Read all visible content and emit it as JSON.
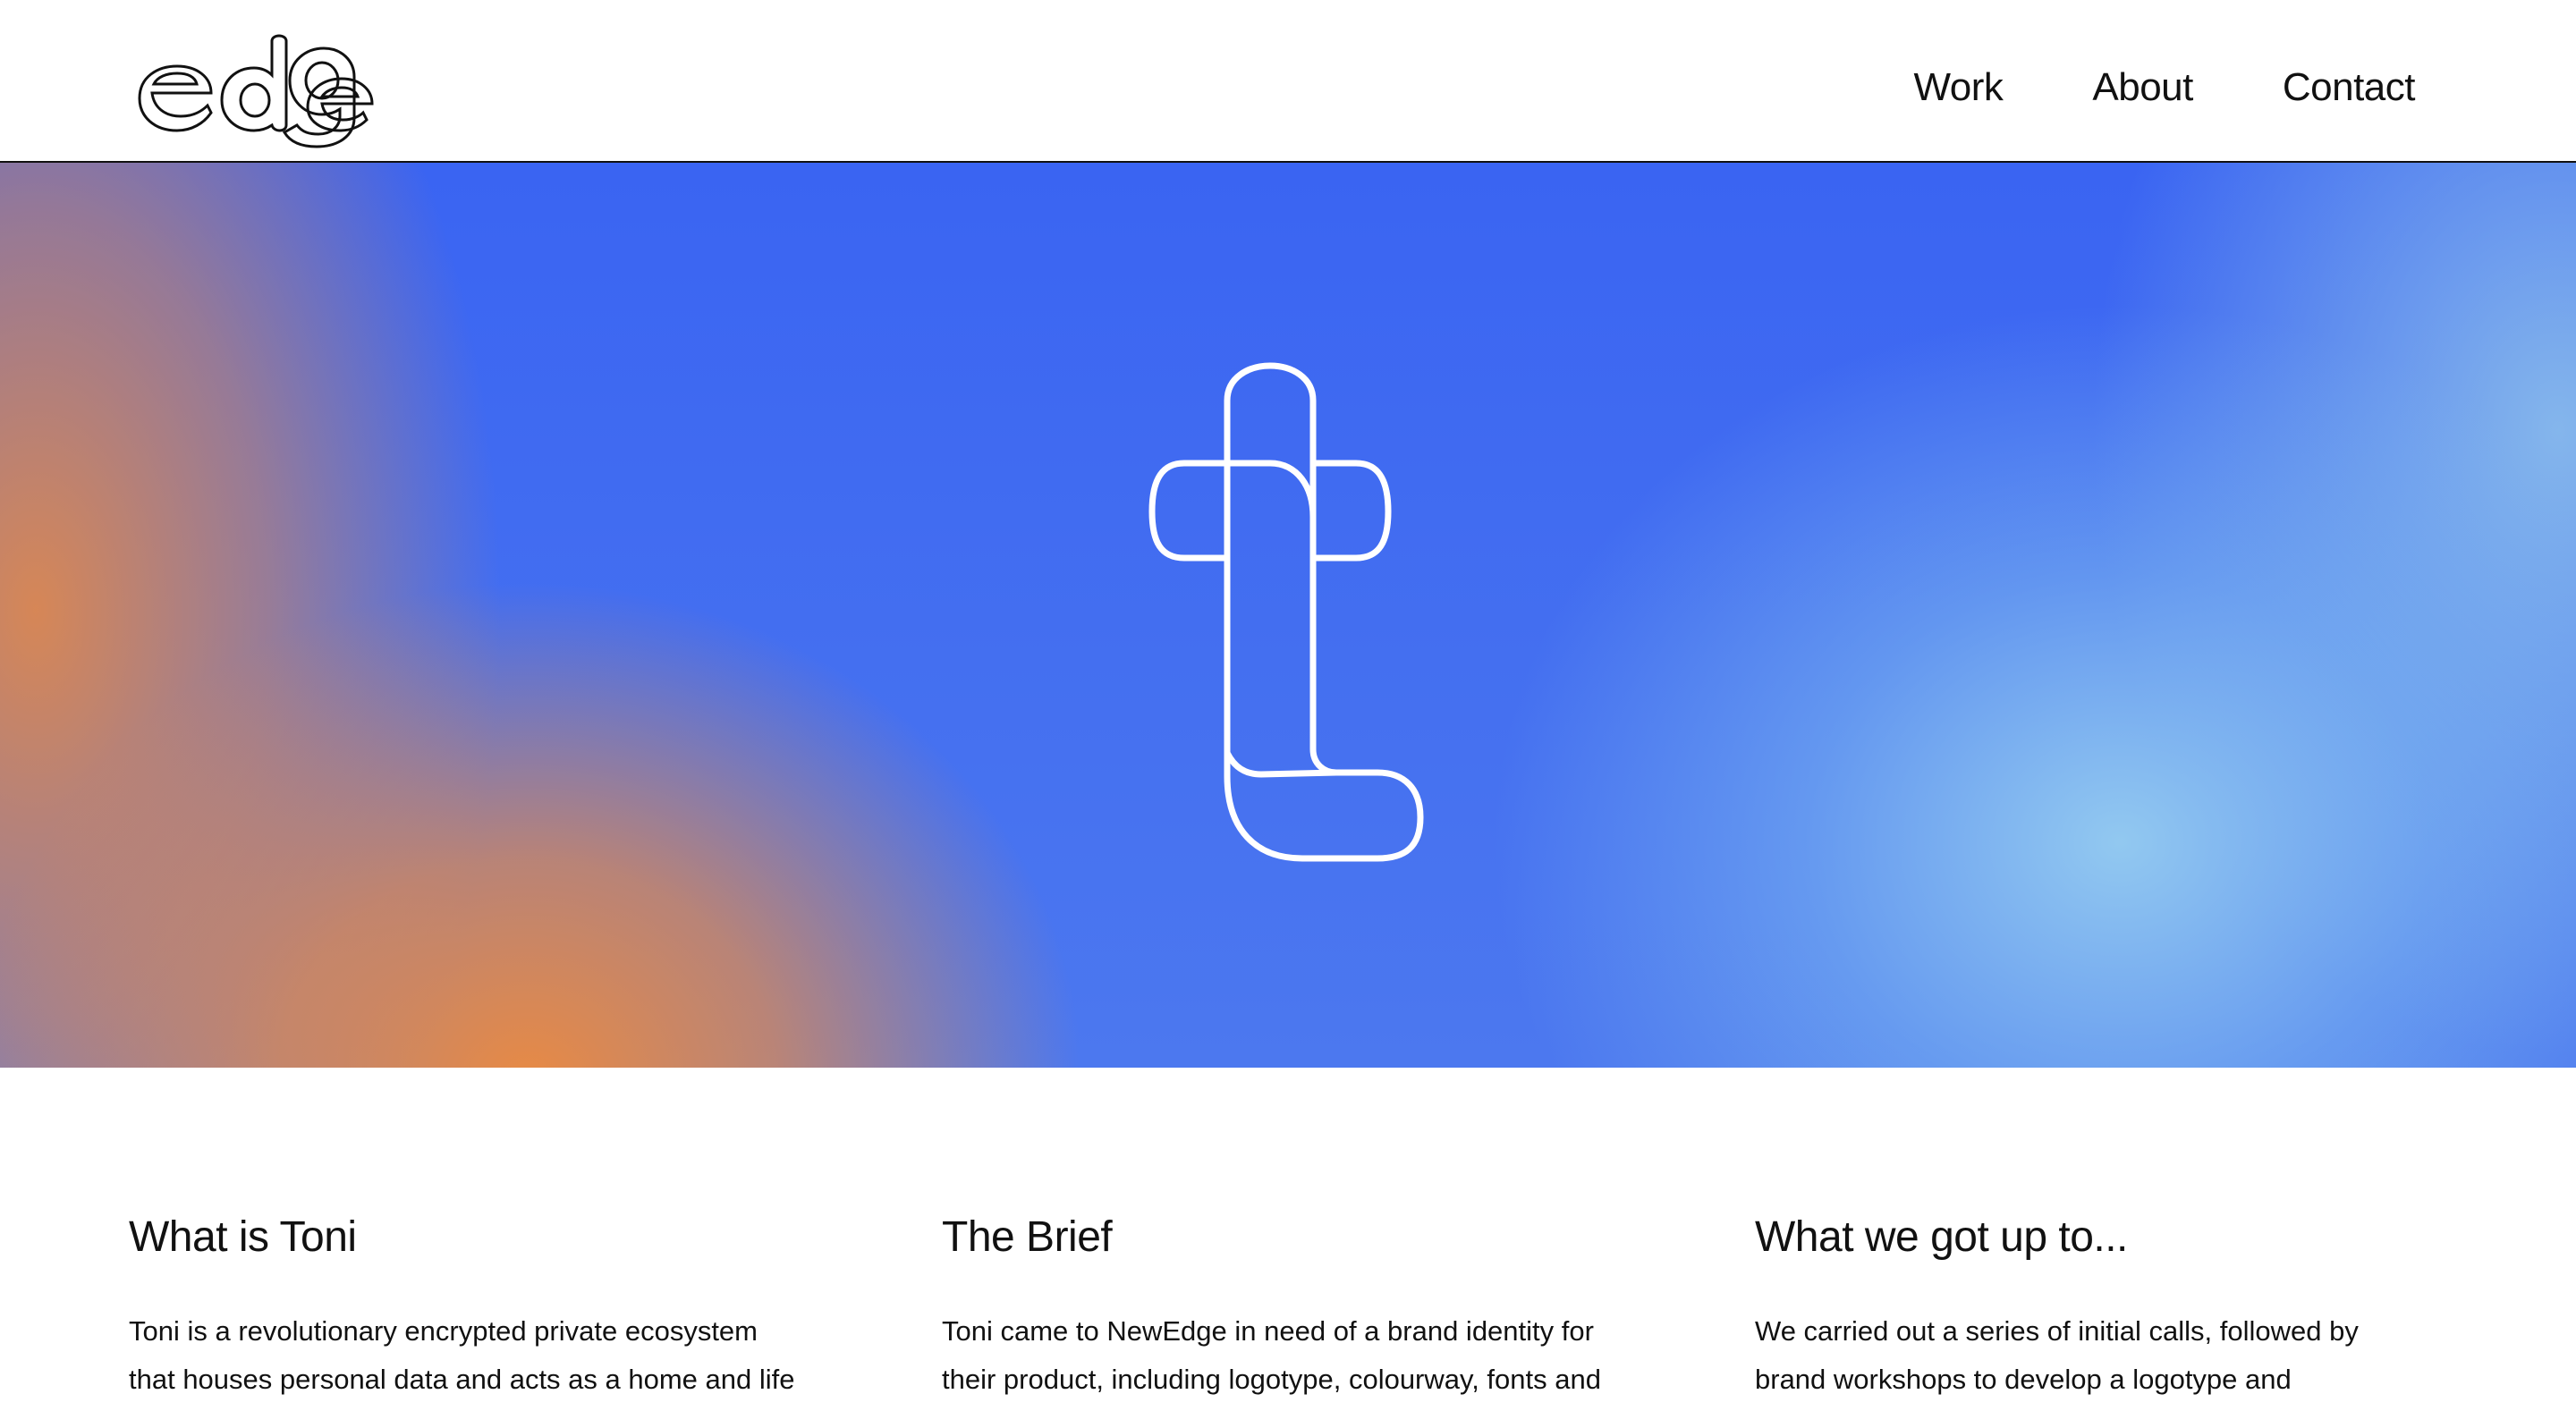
{
  "header": {
    "logo_text": "edge",
    "nav": [
      {
        "label": "Work"
      },
      {
        "label": "About"
      },
      {
        "label": "Contact"
      }
    ]
  },
  "hero": {
    "mark_icon": "toni-t-logomark",
    "colors": {
      "blue": "#3a64f2",
      "orange": "#e88a44",
      "light_blue": "#8cc4ee"
    }
  },
  "sections": [
    {
      "title": "What is Toni",
      "body": "Toni is a revolutionary encrypted private ecosystem\nthat houses personal data and acts as a home and life"
    },
    {
      "title": "The Brief",
      "body": "Toni came to NewEdge in need of a brand identity for\ntheir product, including logotype, colourway, fonts and"
    },
    {
      "title": "What we got up to...",
      "body": "We carried out a series of initial calls, followed by\nbrand workshops to develop a logotype and"
    }
  ]
}
